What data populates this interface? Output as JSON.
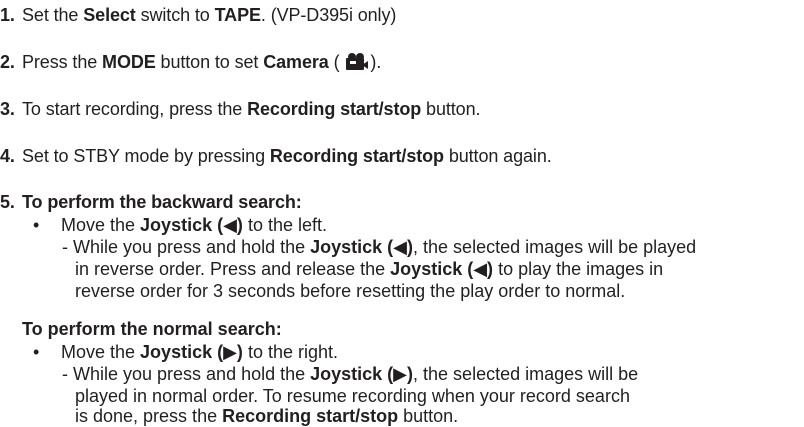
{
  "steps": [
    {
      "number": "1.",
      "parts": [
        "Set the ",
        "Select",
        " switch to ",
        "TAPE",
        ". (VP-D395i only)"
      ]
    },
    {
      "number": "2.",
      "parts": [
        "Press the ",
        "MODE",
        " button to set ",
        "Camera",
        " ( ",
        ")."
      ],
      "icon": "camera-mode-icon"
    },
    {
      "number": "3.",
      "parts": [
        "To start recording, press the ",
        "Recording start/stop",
        " button."
      ]
    },
    {
      "number": "4.",
      "parts": [
        "Set to STBY mode by pressing ",
        "Recording start/stop",
        " button again."
      ]
    },
    {
      "number": "5.",
      "heading": "To perform the backward search:",
      "bullet": [
        "Move the ",
        "Joystick (◀)",
        " to the left."
      ],
      "sub_lines": [
        [
          "- While you press and hold the ",
          "Joystick (◀)",
          ", the selected images will be played"
        ],
        [
          "in reverse order. Press and release the ",
          "Joystick (◀)",
          " to play the images in"
        ],
        [
          "reverse order for 3 seconds before resetting the play order to normal."
        ]
      ]
    },
    {
      "heading": "To perform the normal search:",
      "bullet": [
        "Move the ",
        "Joystick (▶)",
        " to the right."
      ],
      "sub_lines": [
        [
          "- While you press and hold the ",
          "Joystick (▶)",
          ", the selected images will be"
        ],
        [
          "played in normal order. To resume recording when your record search"
        ],
        [
          "is done, press the ",
          "Recording start/stop",
          " button."
        ]
      ]
    }
  ],
  "bullet_char": "•"
}
